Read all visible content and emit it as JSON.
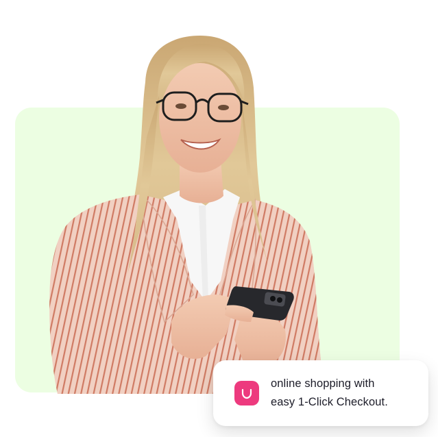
{
  "colors": {
    "panel_bg": "#ecfee2",
    "icon_bg": "#ed3a7e",
    "blazer": "#f1d0c2",
    "stripe": "#cf7a63",
    "hair": "#dcc090",
    "skin": "#f0c3a8",
    "shirt": "#f7f7f7",
    "phone": "#27282c"
  },
  "hero": {
    "image": "woman-with-phone",
    "callout": {
      "icon": "shopping-bag-icon",
      "line1": "online shopping with",
      "line2": "easy 1-Click Checkout."
    }
  }
}
